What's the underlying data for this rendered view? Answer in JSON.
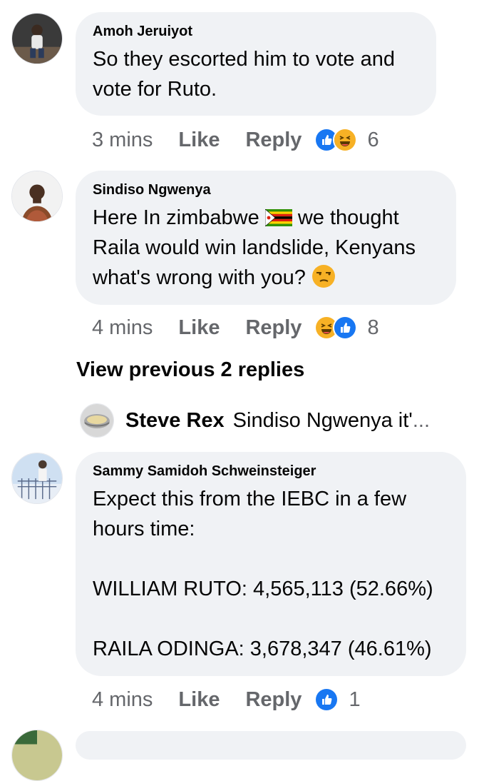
{
  "comments": [
    {
      "author": "Amoh Jeruiyot",
      "text": "So they escorted him to vote and vote for Ruto.",
      "time": "3 mins",
      "like_label": "Like",
      "reply_label": "Reply",
      "reactions": [
        "like-icon",
        "haha-icon"
      ],
      "count": "6"
    },
    {
      "author": "Sindiso Ngwenya",
      "text_parts": [
        "Here In zimbabwe ",
        " we thought Raila would win landslide, Kenyans what's wrong with you? "
      ],
      "inline_icons": [
        "zimbabwe-flag-icon",
        "unamused-face-icon"
      ],
      "time": "4 mins",
      "like_label": "Like",
      "reply_label": "Reply",
      "reactions": [
        "haha-icon",
        "like-icon"
      ],
      "count": "8"
    },
    {
      "author": "Sammy Samidoh Schweinsteiger",
      "text": "Expect this from the IEBC in a few hours time:\n\nWILLIAM RUTO: 4,565,113 (52.66%)\n\nRAILA ODINGA: 3,678,347 (46.61%)",
      "time": "4 mins",
      "like_label": "Like",
      "reply_label": "Reply",
      "reactions": [
        "like-icon"
      ],
      "count": "1"
    }
  ],
  "view_previous": "View previous 2 replies",
  "reply_preview": {
    "author": "Steve Rex",
    "snippet": "Sindiso Ngwenya it'",
    "ellipsis": "..."
  },
  "colors": {
    "bubble": "#f0f2f5",
    "meta_text": "#65676b",
    "like_blue": "#1877f2",
    "haha_yellow": "#f7b125"
  }
}
